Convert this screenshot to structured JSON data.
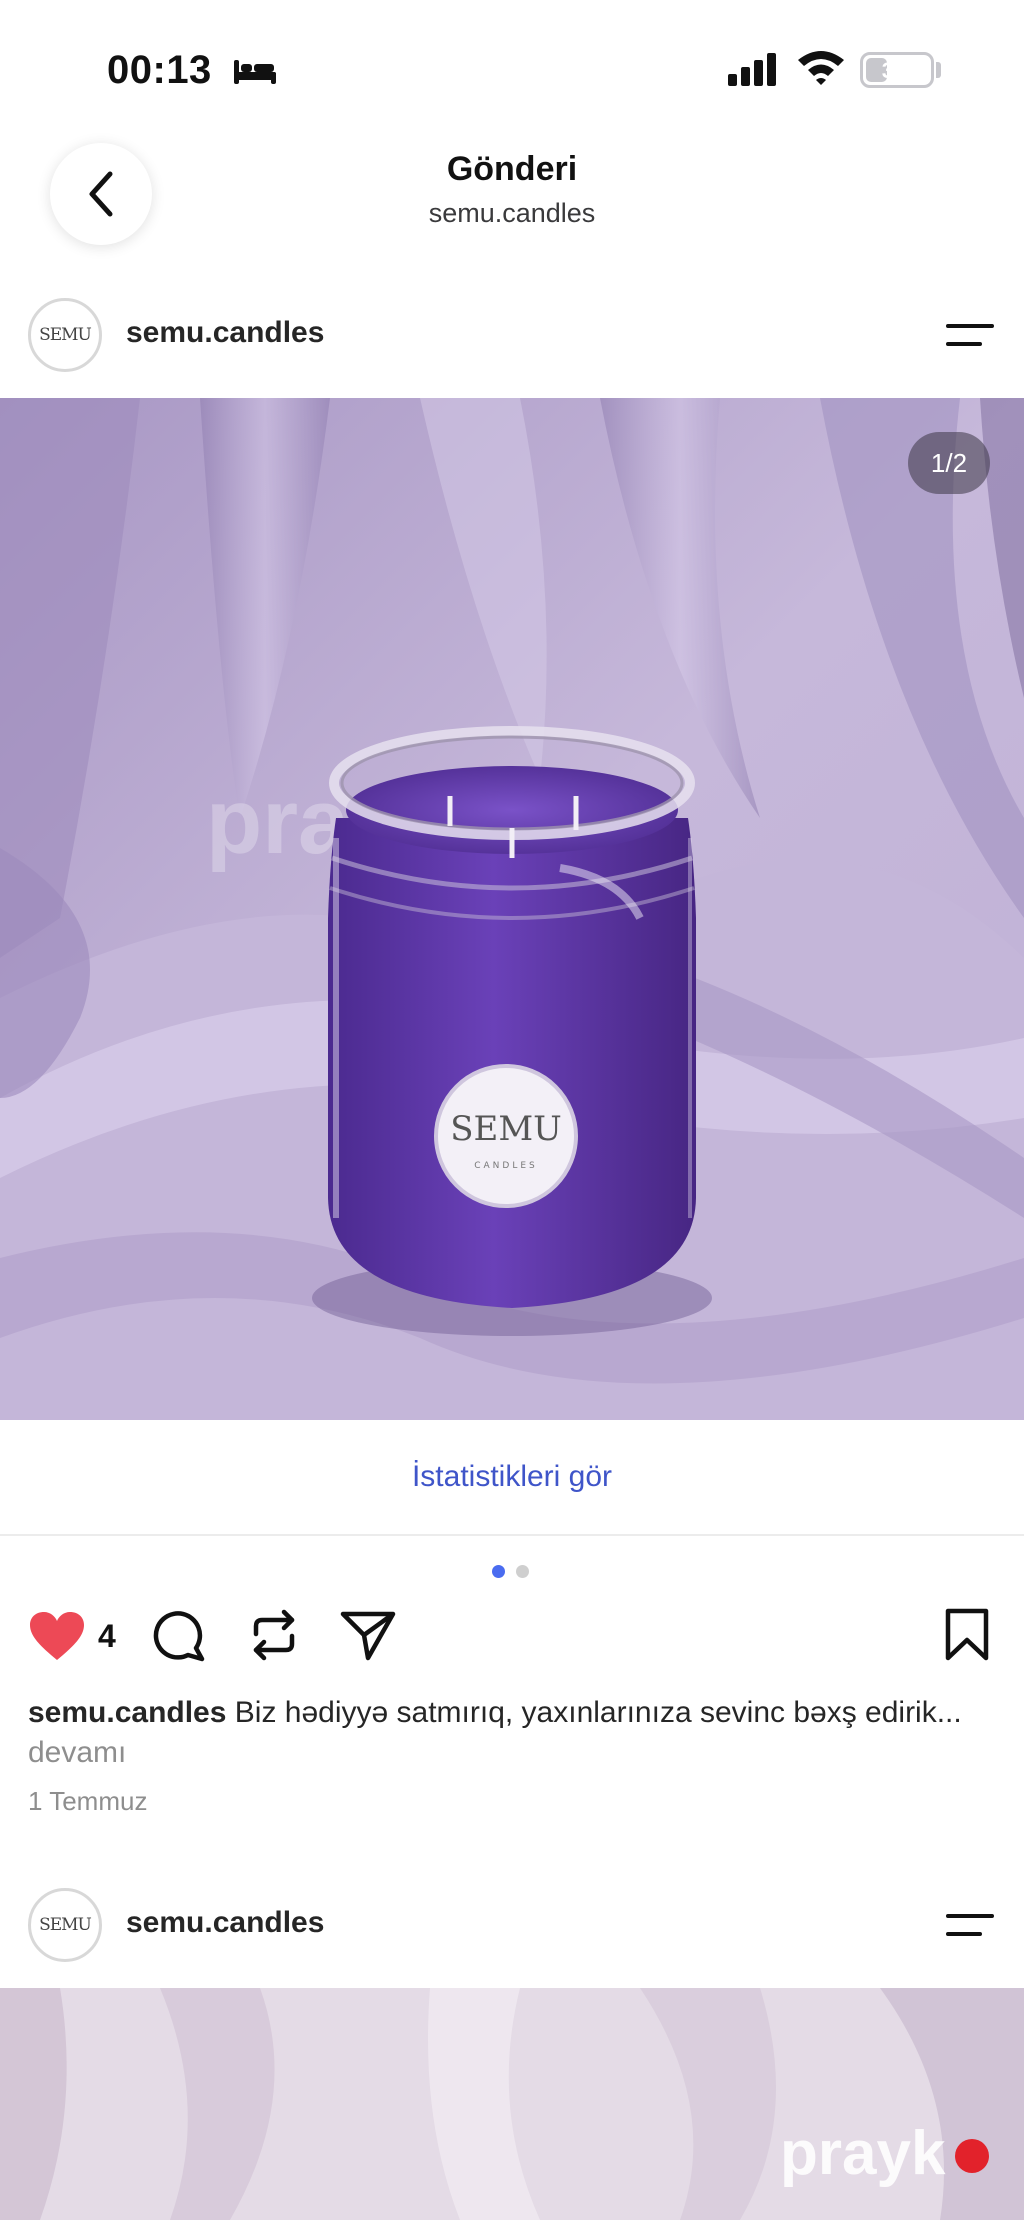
{
  "status_bar": {
    "time": "00:13",
    "battery_text": "34",
    "battery_level": 0.34,
    "icons": [
      "sleep-bed-icon",
      "cellular-signal-icon",
      "wifi-icon",
      "battery-icon"
    ]
  },
  "nav": {
    "title": "Gönderi",
    "subtitle": "semu.candles",
    "back_icon": "chevron-left-icon"
  },
  "post": {
    "username": "semu.candles",
    "avatar_text": "SEMU",
    "page_indicator": "1/2",
    "image_label": "SEMU",
    "image_sublabel": "CANDLES",
    "watermark": "prayk",
    "stats_link": "İstatistikleri gör",
    "carousel": {
      "total": 2,
      "active": 1
    },
    "likes": "4",
    "caption_user": "semu.candles",
    "caption_text": " Biz hədiyyə satmırıq, yaxınlarınıza sevinc bəxş edirik...",
    "caption_more": " devamı",
    "date": "1 Temmuz",
    "actions": [
      "heart-icon",
      "comment-icon",
      "repost-icon",
      "share-icon",
      "bookmark-icon"
    ]
  },
  "next_post": {
    "username": "semu.candles",
    "avatar_text": "SEMU"
  },
  "colors": {
    "like_red": "#ed4956",
    "link_blue": "#3f55c9",
    "dot_active": "#4a6cf0",
    "dot_inactive": "#cfcfcf",
    "watermark_dot": "#e2222b"
  }
}
